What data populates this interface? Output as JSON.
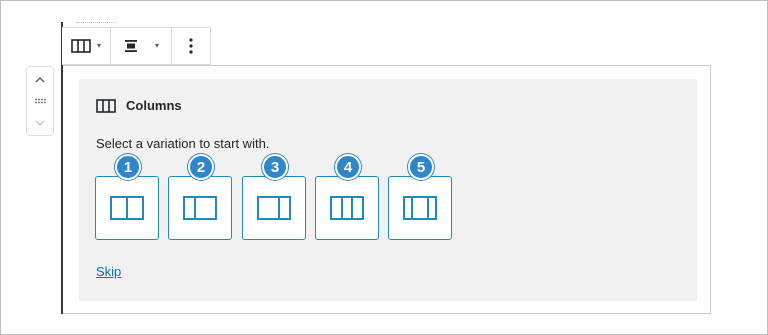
{
  "toolbar": {
    "block_type_icon": "columns-icon",
    "align_icon": "align-center-icon",
    "more_icon": "more-vertical-icon",
    "caret_glyph": "▾"
  },
  "mover": {
    "up_icon": "chevron-up-icon",
    "drag_icon": "drag-handle-icon",
    "down_icon": "chevron-down-icon"
  },
  "placeholder": {
    "title": "Columns",
    "title_icon": "columns-icon",
    "instructions": "Select a variation to start with.",
    "variations": [
      {
        "badge": "1",
        "icon": "two-columns-50-50-icon"
      },
      {
        "badge": "2",
        "icon": "two-columns-30-70-icon"
      },
      {
        "badge": "3",
        "icon": "two-columns-70-30-icon"
      },
      {
        "badge": "4",
        "icon": "three-columns-equal-icon"
      },
      {
        "badge": "5",
        "icon": "three-columns-wide-center-icon"
      }
    ],
    "skip_label": "Skip"
  },
  "colors": {
    "accent": "#1e8cbe",
    "badge": "#2f86c8",
    "link": "#0073aa",
    "placeholder_bg": "#f1f1f1"
  }
}
